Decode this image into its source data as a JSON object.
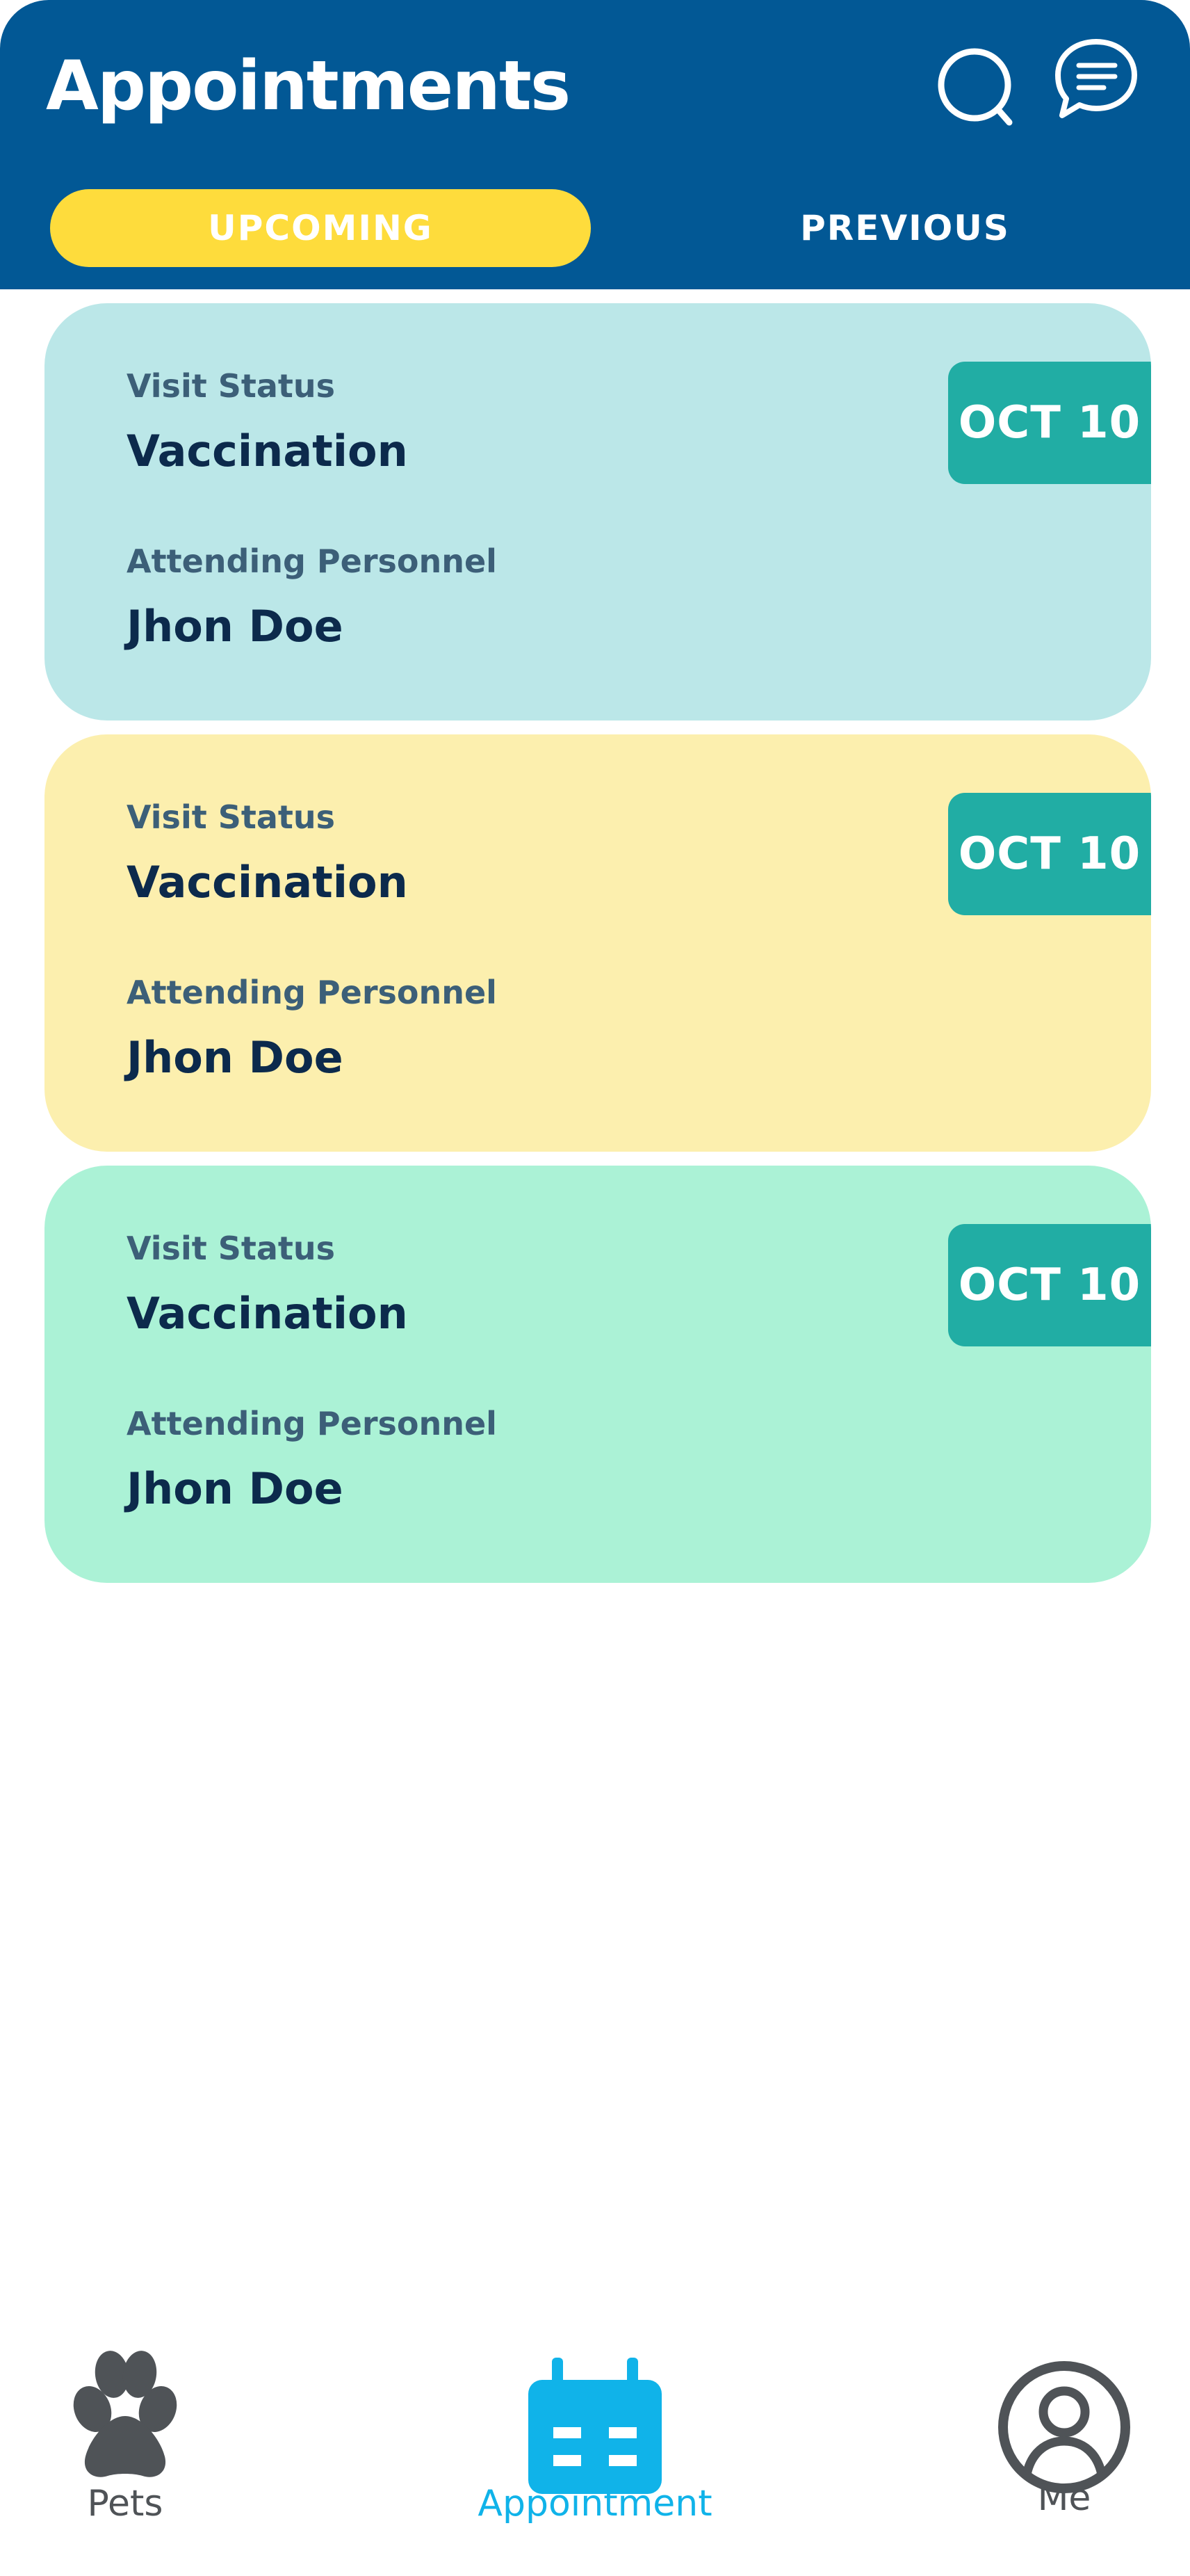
{
  "header": {
    "title": "Appointments",
    "search_icon": "search-icon",
    "chat_icon": "chat-icon"
  },
  "tabs": [
    {
      "label": "UPCOMING",
      "active": true
    },
    {
      "label": "PREVIOUS",
      "active": false
    }
  ],
  "appointments": [
    {
      "status_label": "Visit Status",
      "status": "Vaccination",
      "personnel_label": "Attending Personnel",
      "personnel": "Jhon Doe",
      "date": "OCT 10",
      "color": "#BBE7E8"
    },
    {
      "status_label": "Visit Status",
      "status": "Vaccination",
      "personnel_label": "Attending Personnel",
      "personnel": "Jhon Doe",
      "date": "OCT 10",
      "color": "#FCEFAE"
    },
    {
      "status_label": "Visit Status",
      "status": "Vaccination",
      "personnel_label": "Attending Personnel",
      "personnel": "Jhon Doe",
      "date": "OCT 10",
      "color": "#ABF2D6"
    }
  ],
  "nav": [
    {
      "label": "Pets",
      "icon": "paw-icon",
      "active": false
    },
    {
      "label": "Appointment",
      "icon": "calendar-icon",
      "active": true
    },
    {
      "label": "Me",
      "icon": "user-icon",
      "active": false
    }
  ],
  "colors": {
    "header_bg": "#025895",
    "active_tab": "#FEDC3C",
    "date_badge": "#21ADA4",
    "nav_active": "#10B3E9",
    "nav_inactive": "#4F5357"
  }
}
